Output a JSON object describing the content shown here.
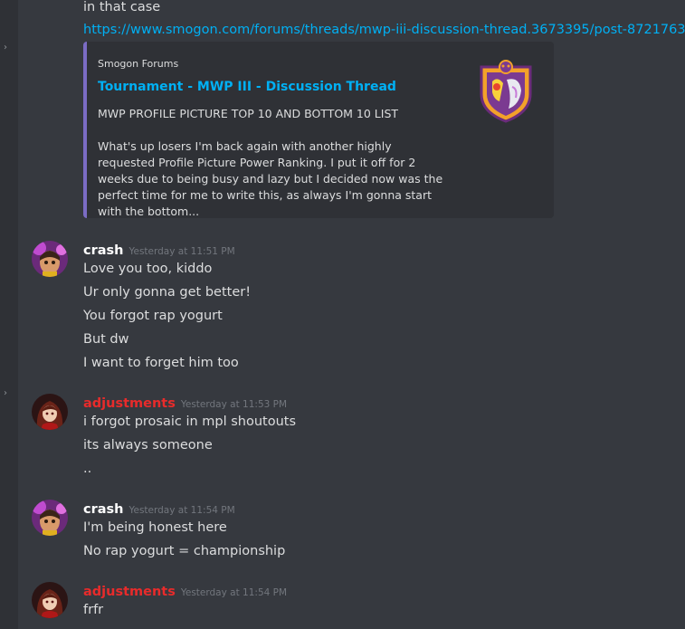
{
  "colors": {
    "background": "#36393f",
    "embed_bg": "#2f3136",
    "embed_border": "#7b6cc4",
    "link": "#00b0f4",
    "crash_name": "#ffffff",
    "adjustments_name": "#e82b2b",
    "timestamp": "#72767d"
  },
  "previous": {
    "text": "in that case",
    "link": "https://www.smogon.com/forums/threads/mwp-iii-discussion-thread.3673395/post-8721763"
  },
  "embed": {
    "provider": "Smogon Forums",
    "title": "Tournament - MWP III - Discussion Thread",
    "subtitle": "MWP PROFILE PICTURE TOP 10 AND BOTTOM 10 LIST",
    "description": "What's up losers I'm back again with another highly requested Profile Picture Power Ranking. I put it off for 2 weeks due to being busy and lazy but I decided now was the perfect time for me to write this, as always I'm gonna start with the bottom...",
    "thumbnail_icon": "tournament-shield-logo-icon"
  },
  "messages": [
    {
      "author": "crash",
      "timestamp": "Yesterday at 11:51 PM",
      "lines": [
        "Love you too, kiddo",
        "Ur only gonna get better!",
        "You forgot rap yogurt",
        "But dw",
        "I want to forget him too"
      ]
    },
    {
      "author": "adjustments",
      "timestamp": "Yesterday at 11:53 PM",
      "lines": [
        "i forgot prosaic in mpl shoutouts",
        "its always someone",
        ".."
      ]
    },
    {
      "author": "crash",
      "timestamp": "Yesterday at 11:54 PM",
      "lines": [
        "I'm being honest here",
        "No rap yogurt = championship"
      ]
    },
    {
      "author": "adjustments",
      "timestamp": "Yesterday at 11:54 PM",
      "lines": [
        "frfr"
      ]
    }
  ]
}
